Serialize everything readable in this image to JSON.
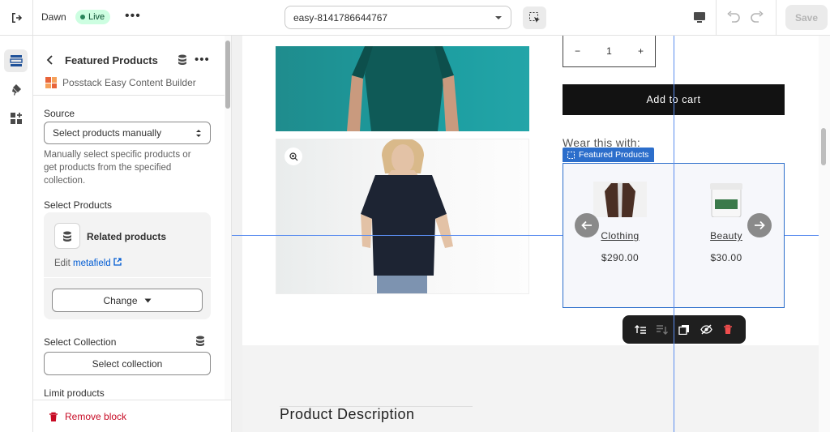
{
  "topbar": {
    "theme_name": "Dawn",
    "live_label": "Live",
    "more_label": "•••",
    "template_value": "easy-8141786644767",
    "save_label": "Save"
  },
  "sidebar": {
    "title": "Featured Products",
    "more_label": "•••",
    "app_name": "Posstack Easy Content Builder",
    "source_label": "Source",
    "source_value": "Select products manually",
    "source_help": "Manually select specific products or get products from the specified collection.",
    "select_products_label": "Select Products",
    "related_title": "Related products",
    "edit_prefix": "Edit",
    "edit_link": "metafield",
    "change_label": "Change",
    "select_collection_label": "Select Collection",
    "select_collection_button": "Select collection",
    "limit_label": "Limit products",
    "remove_label": "Remove block"
  },
  "preview": {
    "quantity_minus": "−",
    "quantity_value": "1",
    "quantity_plus": "+",
    "add_to_cart": "Add to cart",
    "wear_title": "Wear this with:",
    "block_tag": "Featured Products",
    "products": [
      {
        "name": "Clothing",
        "price": "$290.00"
      },
      {
        "name": "Beauty",
        "price": "$30.00"
      }
    ],
    "description_title": "Product Description"
  },
  "colors": {
    "accent": "#2c6ecb",
    "live_bg": "#cdfee1",
    "danger": "#c70a24",
    "button_dark": "#121212"
  }
}
